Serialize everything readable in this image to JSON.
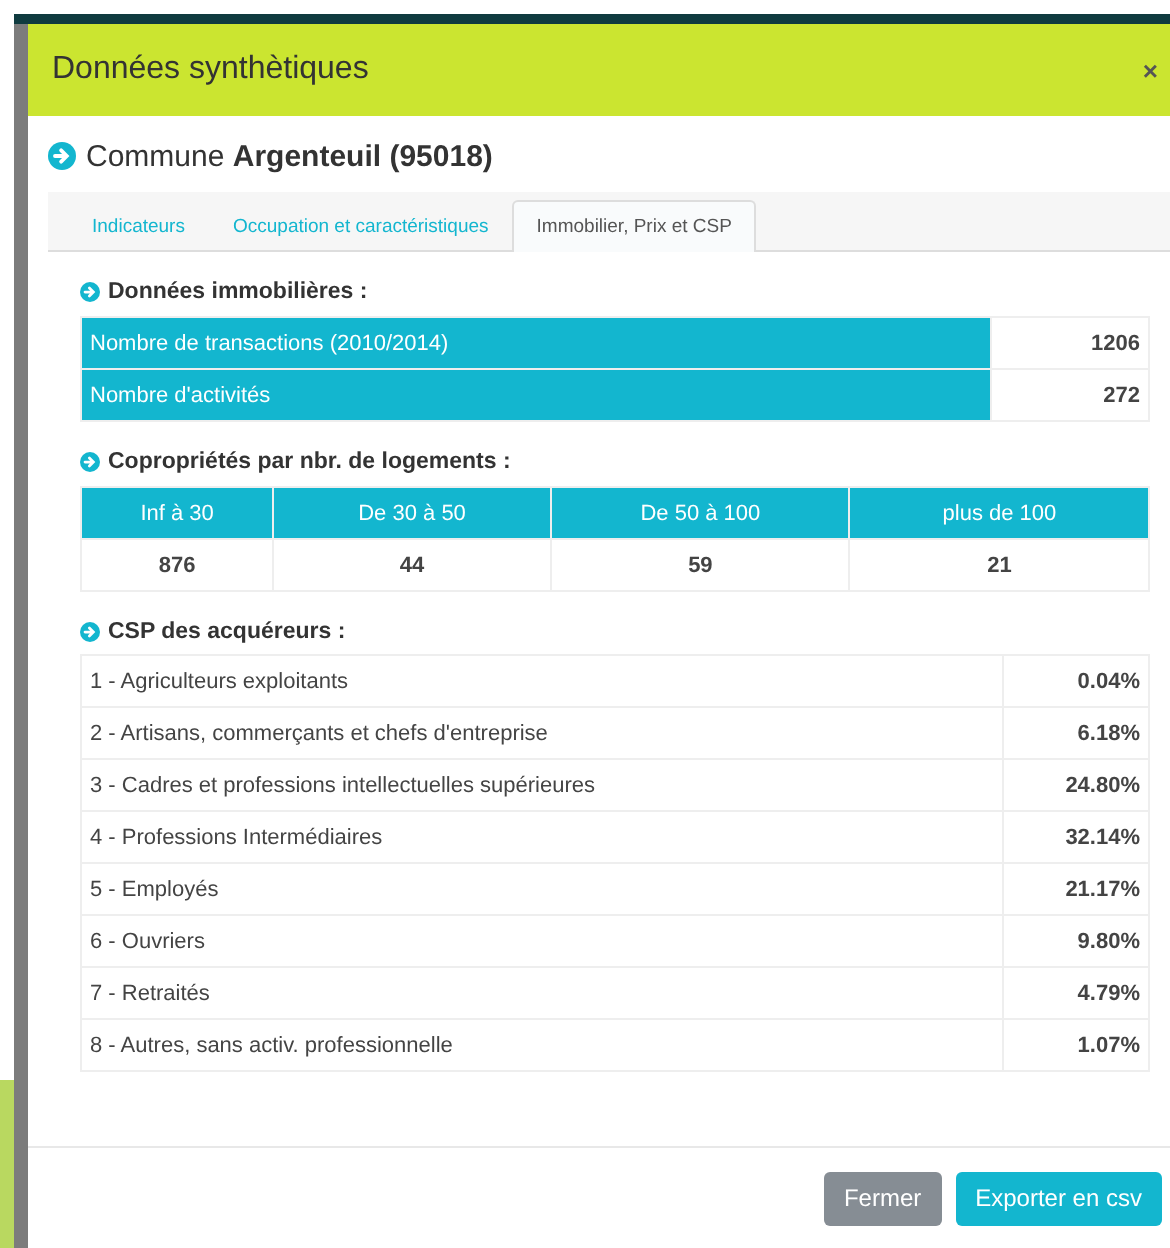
{
  "dialog": {
    "title": "Données synthètiques",
    "close": "×"
  },
  "commune": {
    "prefix": "Commune",
    "name": "Argenteuil (95018)"
  },
  "tabs": [
    {
      "label": "Indicateurs",
      "selected": false
    },
    {
      "label": "Occupation et caractéristiques",
      "selected": false
    },
    {
      "label": "Immobilier, Prix et CSP",
      "selected": true
    }
  ],
  "real_estate": {
    "title": "Données immobilières :",
    "rows": [
      {
        "label": "Nombre de transactions (2010/2014)",
        "value": "1206"
      },
      {
        "label": "Nombre d'activités",
        "value": "272"
      }
    ]
  },
  "condominiums": {
    "title": "Copropriétés par nbr. de logements :",
    "columns": [
      "Inf à 30",
      "De 30 à 50",
      "De 50 à 100",
      "plus de 100"
    ],
    "values": [
      "876",
      "44",
      "59",
      "21"
    ]
  },
  "buyers_csp": {
    "title": "CSP des acquéreurs :",
    "rows": [
      {
        "label": "1 - Agriculteurs exploitants",
        "value": "0.04%"
      },
      {
        "label": "2 - Artisans, commerçants et chefs d'entreprise",
        "value": "6.18%"
      },
      {
        "label": "3 - Cadres et professions intellectuelles supérieures",
        "value": "24.80%"
      },
      {
        "label": "4 - Professions Intermédiaires",
        "value": "32.14%"
      },
      {
        "label": "5 - Employés",
        "value": "21.17%"
      },
      {
        "label": "6 - Ouvriers",
        "value": "9.80%"
      },
      {
        "label": "7 - Retraités",
        "value": "4.79%"
      },
      {
        "label": "8 - Autres, sans activ. professionnelle",
        "value": "1.07%"
      }
    ]
  },
  "buttons": [
    {
      "label": "Fermer",
      "kind": "secondary"
    },
    {
      "label": "Exporter en csv",
      "kind": "primary"
    }
  ]
}
